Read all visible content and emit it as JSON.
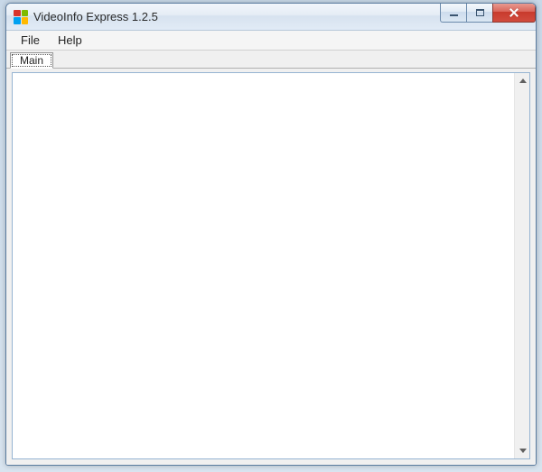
{
  "window": {
    "title": "VideoInfo Express 1.2.5"
  },
  "menubar": {
    "items": [
      {
        "label": "File"
      },
      {
        "label": "Help"
      }
    ]
  },
  "tabs": {
    "items": [
      {
        "label": "Main",
        "active": true
      }
    ]
  },
  "content": {
    "text": ""
  },
  "icons": {
    "app": "app-icon",
    "minimize": "minimize-icon",
    "maximize": "maximize-icon",
    "close": "close-icon",
    "scroll_up": "scroll-up-icon",
    "scroll_down": "scroll-down-icon"
  }
}
